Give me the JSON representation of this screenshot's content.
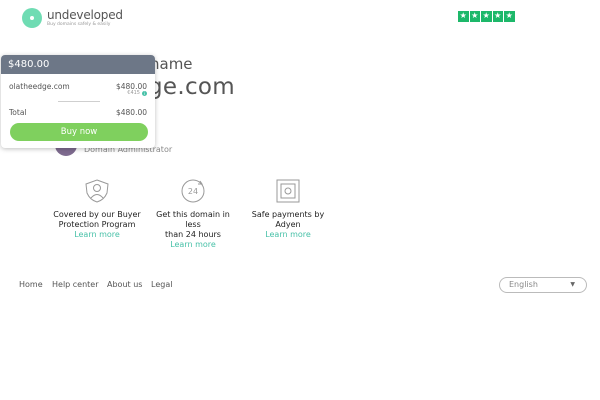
{
  "header": {
    "logo_name": "undeveloped",
    "logo_tagline": "Buy domains safely & easily",
    "rating_stars": 5,
    "star_glyph": "★"
  },
  "background": {
    "label_partial": "name",
    "domain_partial": "ge.com",
    "seller_role": "Domain Administrator"
  },
  "card": {
    "price": "$480.00",
    "domain": "olatheedge.com",
    "domain_price": "$480.00",
    "sub_price": "€415",
    "info_glyph": "i",
    "total_label": "Total",
    "total_value": "$480.00",
    "buy_label": "Buy now"
  },
  "features": [
    {
      "icon": "shield-person-icon",
      "title_line1": "Covered by our Buyer",
      "title_line2": "Protection Program",
      "link": "Learn more"
    },
    {
      "icon": "24-hour-clock-icon",
      "title_line1": "Get this domain in less",
      "title_line2": "than 24 hours",
      "link": "Learn more"
    },
    {
      "icon": "safe-vault-icon",
      "title_line1": "Safe payments by",
      "title_line2": "Adyen",
      "link": "Learn more"
    }
  ],
  "footer": {
    "links": [
      "Home",
      "Help center",
      "About us",
      "Legal"
    ],
    "language": "English",
    "language_caret": "▼"
  },
  "colors": {
    "accent": "#48c1a8",
    "buy_button": "#7fd05e",
    "card_header": "#6d7787",
    "trustpilot": "#1db86a"
  }
}
